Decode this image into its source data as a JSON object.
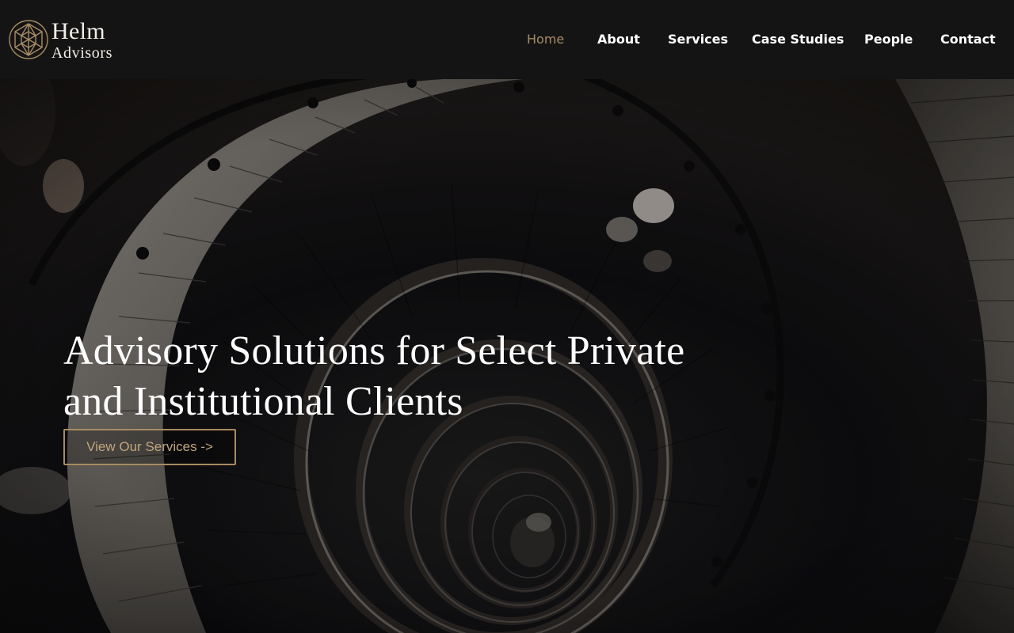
{
  "brand": {
    "name": "Helm",
    "sub": "Advisors"
  },
  "nav": {
    "items": [
      {
        "label": "Home",
        "active": true
      },
      {
        "label": "About"
      },
      {
        "label": "Services"
      },
      {
        "label": "Case Studies"
      },
      {
        "label": "People"
      },
      {
        "label": "Contact"
      }
    ]
  },
  "hero": {
    "title_line1": "Advisory Solutions for Select Private",
    "title_line2": "and Institutional Clients",
    "cta_label": "View Our Services ->"
  },
  "colors": {
    "accent": "#a88b63",
    "navbar_bg": "#141414",
    "text": "#ffffff"
  },
  "icons": {
    "logo": "geodesic-sphere-icon"
  }
}
